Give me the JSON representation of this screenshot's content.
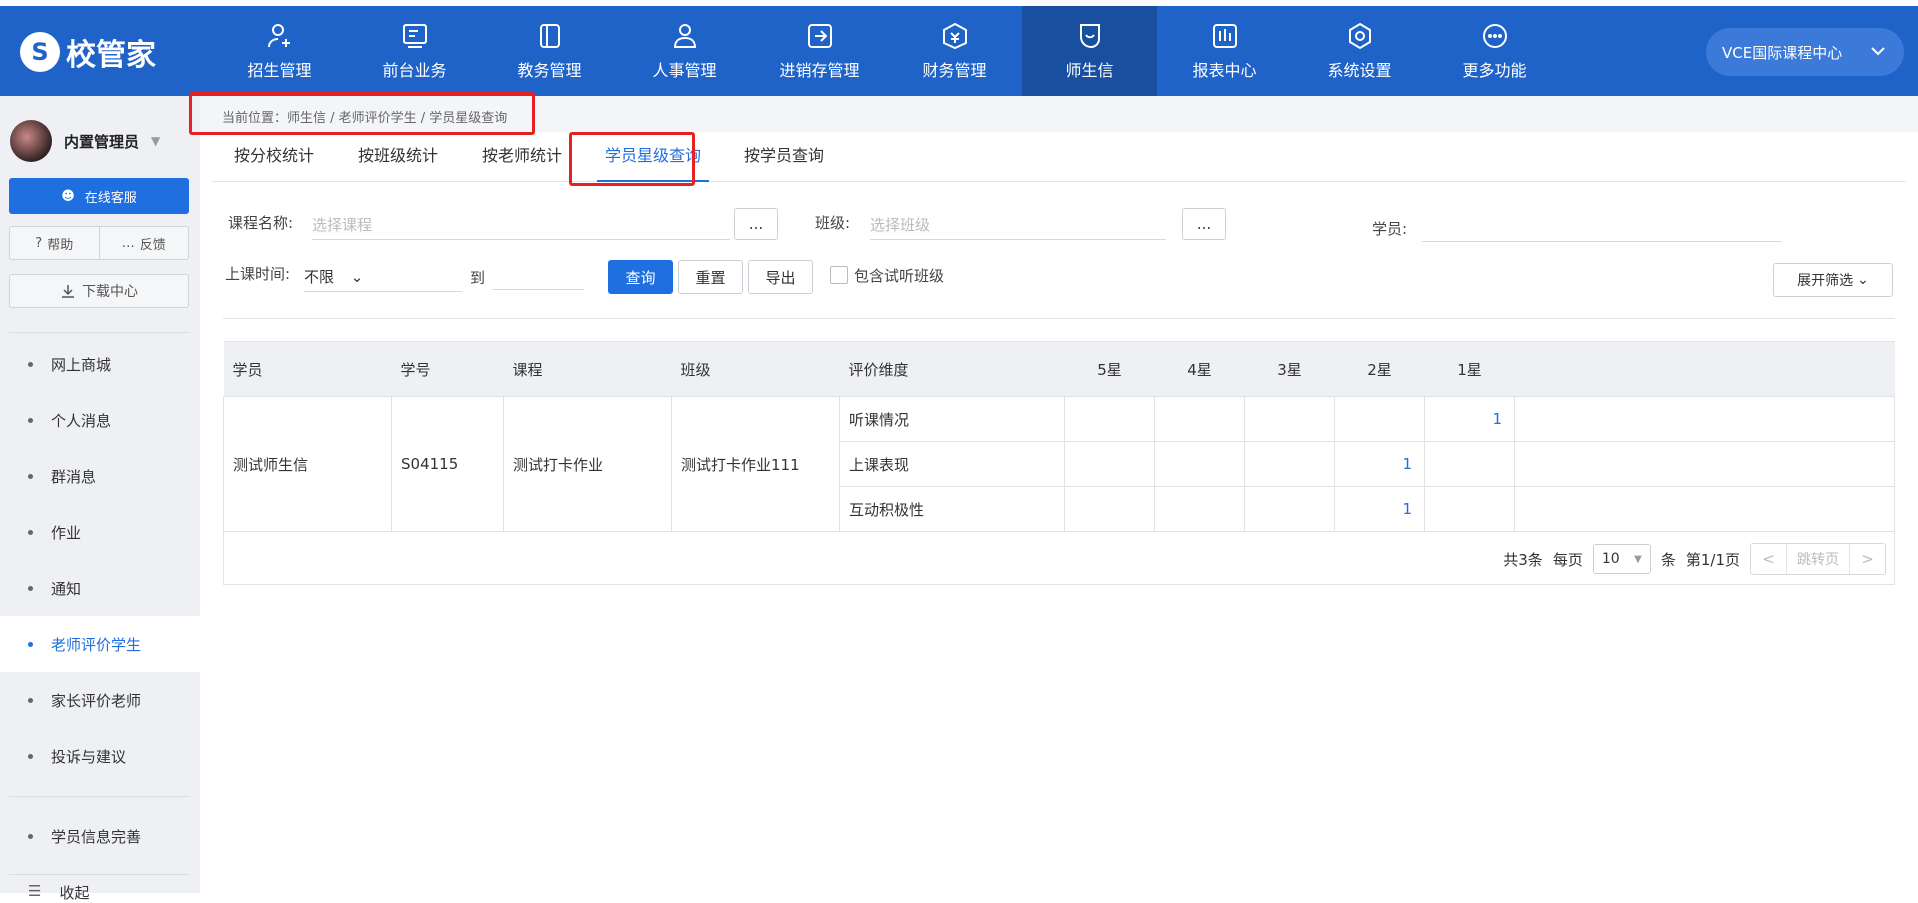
{
  "logo": {
    "text": "校管家"
  },
  "nav": [
    {
      "label": "招生管理",
      "icon": "user-add-icon"
    },
    {
      "label": "前台业务",
      "icon": "desk-icon"
    },
    {
      "label": "教务管理",
      "icon": "book-icon"
    },
    {
      "label": "人事管理",
      "icon": "person-icon"
    },
    {
      "label": "进销存管理",
      "icon": "inventory-icon"
    },
    {
      "label": "财务管理",
      "icon": "finance-icon"
    },
    {
      "label": "师生信",
      "icon": "chat-icon"
    },
    {
      "label": "报表中心",
      "icon": "report-icon"
    },
    {
      "label": "系统设置",
      "icon": "settings-icon"
    },
    {
      "label": "更多功能",
      "icon": "more-icon"
    }
  ],
  "campus": {
    "label": "VCE国际课程中心"
  },
  "sidebar": {
    "user_name": "内置管理员",
    "service": "在线客服",
    "help": "帮助",
    "feedback": "反馈",
    "download": "下载中心",
    "items": [
      {
        "label": "网上商城"
      },
      {
        "label": "个人消息"
      },
      {
        "label": "群消息"
      },
      {
        "label": "作业"
      },
      {
        "label": "通知"
      },
      {
        "label": "老师评价学生"
      },
      {
        "label": "家长评价老师"
      },
      {
        "label": "投诉与建议"
      },
      {
        "label": "学员信息完善"
      },
      {
        "label": "收起"
      }
    ]
  },
  "breadcrumb": "当前位置：师生信 / 老师评价学生 / 学员星级查询",
  "tabs": [
    {
      "label": "按分校统计"
    },
    {
      "label": "按班级统计"
    },
    {
      "label": "按老师统计"
    },
    {
      "label": "学员星级查询"
    },
    {
      "label": "按学员查询"
    }
  ],
  "filters": {
    "course_label": "课程名称:",
    "course_placeholder": "选择课程",
    "class_label": "班级:",
    "class_placeholder": "选择班级",
    "student_label": "学员:",
    "picker": "...",
    "time_label": "上课时间:",
    "time_value": "不限",
    "to": "到",
    "search": "查询",
    "reset": "重置",
    "export": "导出",
    "include_trial": "包含试听班级",
    "expand": "展开筛选"
  },
  "table": {
    "headers": [
      "学员",
      "学号",
      "课程",
      "班级",
      "评价维度",
      "5星",
      "4星",
      "3星",
      "2星",
      "1星"
    ],
    "student": "测试师生信",
    "student_no": "S04115",
    "course": "测试打卡作业",
    "class": "测试打卡作业111",
    "rows": [
      {
        "dimension": "听课情况",
        "stars": [
          "",
          "",
          "",
          "",
          "1"
        ]
      },
      {
        "dimension": "上课表现",
        "stars": [
          "",
          "",
          "",
          "1",
          ""
        ]
      },
      {
        "dimension": "互动积极性",
        "stars": [
          "",
          "",
          "",
          "1",
          ""
        ]
      }
    ]
  },
  "pagination": {
    "total": "共3条",
    "per_page_label": "每页",
    "per_page": "10",
    "unit": "条",
    "page_info": "第1/1页",
    "jump": "跳转页"
  }
}
